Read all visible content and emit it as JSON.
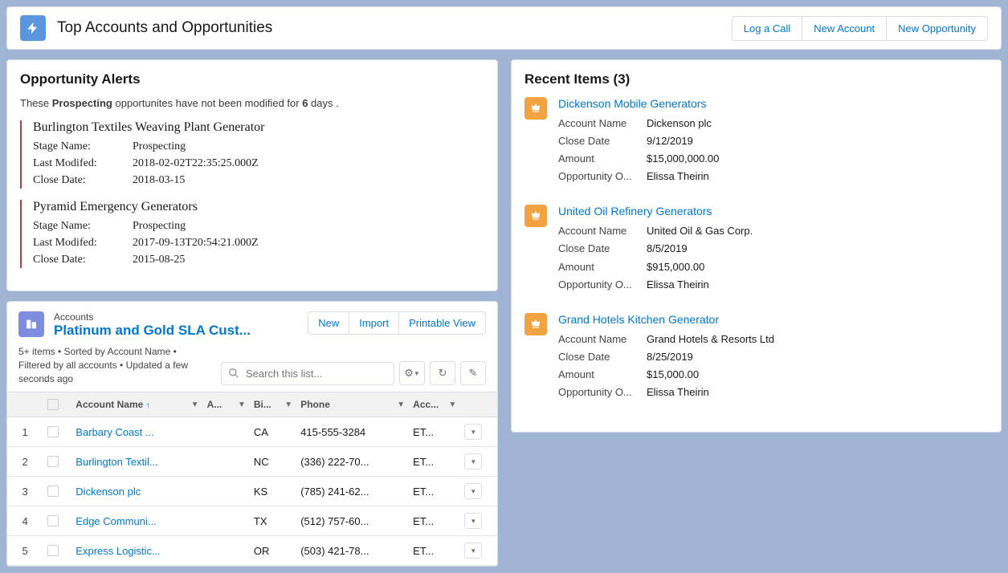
{
  "header": {
    "title": "Top Accounts and Opportunities",
    "actions": [
      "Log a Call",
      "New Account",
      "New Opportunity"
    ]
  },
  "alerts": {
    "panel_title": "Opportunity Alerts",
    "sentence_pre": "These ",
    "stage_word": "Prospecting",
    "sentence_mid": " opportunites have not been modified for ",
    "sentence_days": "6",
    "sentence_post": " days .",
    "labels": {
      "stage": "Stage Name:",
      "modified": "Last Modifed:",
      "close": "Close Date:"
    },
    "items": [
      {
        "title": "Burlington Textiles Weaving Plant Generator",
        "stage": "Prospecting",
        "modified": "2018-02-02T22:35:25.000Z",
        "close": "2018-03-15"
      },
      {
        "title": "Pyramid Emergency Generators",
        "stage": "Prospecting",
        "modified": "2017-09-13T20:54:21.000Z",
        "close": "2015-08-25"
      }
    ]
  },
  "listview": {
    "object_label": "Accounts",
    "view_name": "Platinum and Gold SLA Cust...",
    "actions": [
      "New",
      "Import",
      "Printable View"
    ],
    "meta": "5+ items • Sorted by Account Name • Filtered by all accounts • Updated a few seconds ago",
    "search_placeholder": "Search this list...",
    "columns": [
      "",
      "",
      "Account Name",
      "A...",
      "Bi...",
      "Phone",
      "Acc...",
      ""
    ],
    "rows": [
      {
        "idx": "1",
        "name": "Barbary Coast ...",
        "col_a": "",
        "state": "CA",
        "phone": "415-555-3284",
        "acc": "ET...",
        "action": "▼"
      },
      {
        "idx": "2",
        "name": "Burlington Textil...",
        "col_a": "",
        "state": "NC",
        "phone": "(336) 222-70...",
        "acc": "ET...",
        "action": "▼"
      },
      {
        "idx": "3",
        "name": "Dickenson plc",
        "col_a": "",
        "state": "KS",
        "phone": "(785) 241-62...",
        "acc": "ET...",
        "action": "▼"
      },
      {
        "idx": "4",
        "name": "Edge Communi...",
        "col_a": "",
        "state": "TX",
        "phone": "(512) 757-60...",
        "acc": "ET...",
        "action": "▼"
      },
      {
        "idx": "5",
        "name": "Express Logistic...",
        "col_a": "",
        "state": "OR",
        "phone": "(503) 421-78...",
        "acc": "ET...",
        "action": "▼"
      }
    ]
  },
  "recent": {
    "panel_title": "Recent Items (3)",
    "labels": {
      "account": "Account Name",
      "close": "Close Date",
      "amount": "Amount",
      "owner": "Opportunity O..."
    },
    "items": [
      {
        "name": "Dickenson Mobile Generators",
        "account": "Dickenson plc",
        "close": "9/12/2019",
        "amount": "$15,000,000.00",
        "owner": "Elissa Theirin"
      },
      {
        "name": "United Oil Refinery Generators",
        "account": "United Oil & Gas Corp.",
        "close": "8/5/2019",
        "amount": "$915,000.00",
        "owner": "Elissa Theirin"
      },
      {
        "name": "Grand Hotels Kitchen Generator",
        "account": "Grand Hotels & Resorts Ltd",
        "close": "8/25/2019",
        "amount": "$15,000.00",
        "owner": "Elissa Theirin"
      }
    ]
  }
}
